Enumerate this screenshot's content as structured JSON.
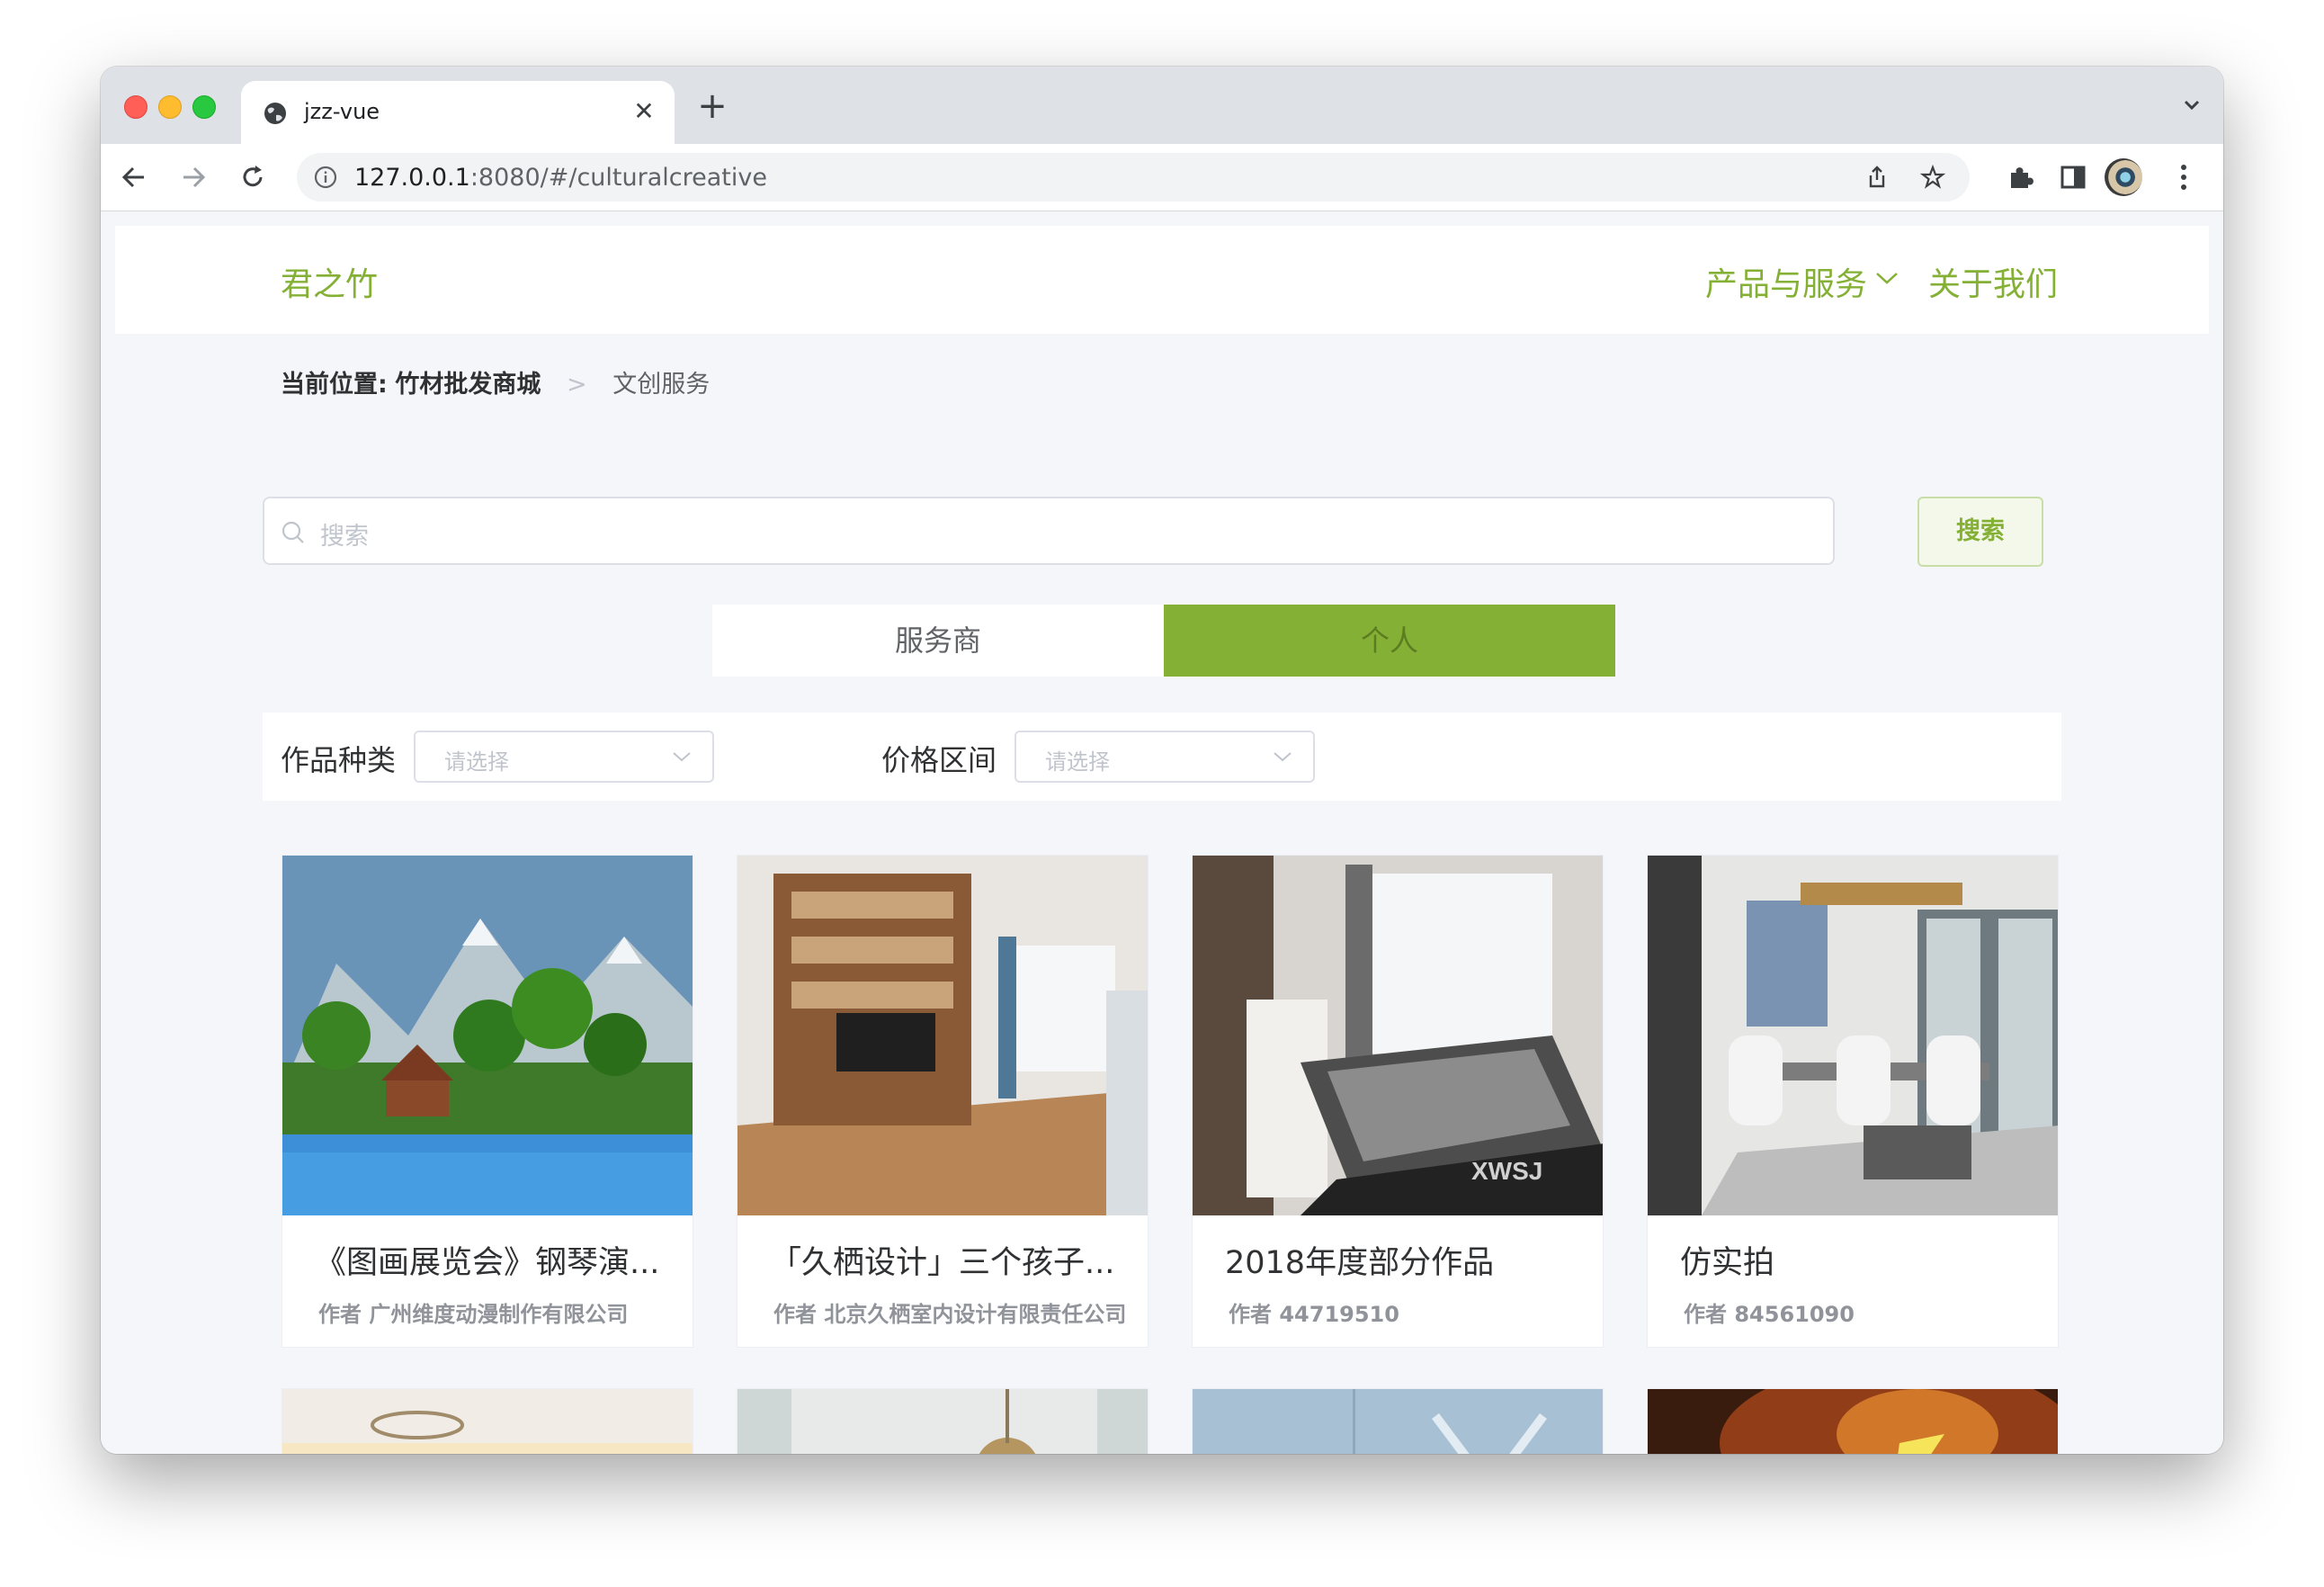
{
  "browser": {
    "tab_title": "jzz-vue",
    "url_host": "127.0.0.1",
    "url_rest": ":8080/#/culturalcreative"
  },
  "header": {
    "logo": "君之竹",
    "nav_products": "产品与服务",
    "nav_about": "关于我们"
  },
  "breadcrumb": {
    "prefix": "当前位置:",
    "home": "竹材批发商城",
    "separator": ">",
    "current": "文创服务"
  },
  "search": {
    "placeholder": "搜索",
    "button_label": "搜索"
  },
  "toggle": {
    "left_label": "服务商",
    "right_label": "个人",
    "active": "个人"
  },
  "filters": {
    "category_label": "作品种类",
    "category_placeholder": "请选择",
    "price_label": "价格区间",
    "price_placeholder": "请选择"
  },
  "cards": [
    {
      "title": "《图画展览会》钢琴演...",
      "author_prefix": "作者",
      "author": "广州维度动漫制作有限公司"
    },
    {
      "title": "「久栖设计」三个孩子...",
      "author_prefix": "作者",
      "author": "北京久栖室内设计有限责任公司"
    },
    {
      "title": "2018年度部分作品",
      "author_prefix": "作者",
      "author": "44719510"
    },
    {
      "title": "仿实拍",
      "author_prefix": "作者",
      "author": "84561090"
    }
  ],
  "colors": {
    "brand_green": "#84b135",
    "page_background": "#f5f6fa"
  }
}
